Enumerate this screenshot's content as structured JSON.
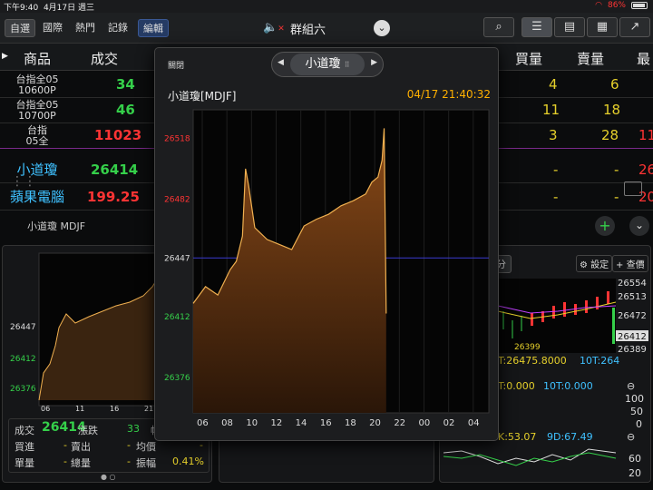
{
  "status": {
    "time": "下午9:40",
    "date": "4月17日 週三",
    "battery": "86%"
  },
  "tabs": [
    {
      "label": "自選"
    },
    {
      "label": "國際"
    },
    {
      "label": "熱門"
    },
    {
      "label": "記錄"
    }
  ],
  "edit_label": "編輯",
  "group_title": "群組六",
  "columns": {
    "name": "商品",
    "trade": "成交",
    "buy_vol": "買量",
    "sell_vol": "賣量",
    "last": "最"
  },
  "rows": [
    {
      "name1": "台指全05",
      "name2": "10600P",
      "trade": "34",
      "buy": "4",
      "sell": "6",
      "tail": ""
    },
    {
      "name1": "台指全05",
      "name2": "10700P",
      "trade": "46",
      "buy": "11",
      "sell": "18",
      "tail": ""
    },
    {
      "name1": "台指",
      "name2": "05全",
      "trade": "11023",
      "buy": "3",
      "sell": "28",
      "tail": "11"
    },
    {
      "name1": "小道瓊",
      "name2": "",
      "trade": "26414",
      "buy": "-",
      "sell": "-",
      "tail": "26"
    },
    {
      "name1": "蘋果電腦",
      "name2": "",
      "trade": "199.25",
      "buy": "-",
      "sell": "-",
      "tail": "20"
    }
  ],
  "mid_label": "小道瓊  MDJF",
  "left_panel": {
    "yticks": [
      "26447",
      "26412",
      "26376"
    ],
    "xticks": [
      "06",
      "11",
      "16",
      "21"
    ],
    "info": {
      "trade_l": "成交",
      "trade_v": "26414",
      "chg_l": "漲跌",
      "chg_v": "33",
      "amp_l": "幅度",
      "buy_l": "買進",
      "buy_v": "-",
      "sell_l": "賣出",
      "sell_v": "-",
      "avg_l": "均價",
      "avg_v": "-",
      "single_l": "單量",
      "single_v": "-",
      "total_l": "總量",
      "total_v": "-",
      "swing_l": "振幅",
      "swing_v": "0.41%"
    }
  },
  "right_panel": {
    "period_btn": "分",
    "settings": "設定",
    "add": "查價",
    "prices": [
      "26554",
      "26513",
      "26472",
      "26412",
      "26389"
    ],
    "low_mark": "26399",
    "ma_line": "T:26475.8000",
    "ma_line2": "10T:264",
    "vol_line": "T:0.000",
    "vol_line2": "10T:0.000",
    "vol_ticks": [
      "100",
      "50",
      "0"
    ],
    "kd_line": "K:53.07",
    "kd_line2": "9D:67.49",
    "kd_ticks": [
      "60",
      "20"
    ]
  },
  "popup": {
    "close": "關閉",
    "product": "小道瓊",
    "title": "小道瓊[MDJF]",
    "timestamp": "04/17 21:40:32"
  },
  "chart_data": {
    "type": "area",
    "title": "小道瓊[MDJF]",
    "x_ticks": [
      "06",
      "08",
      "10",
      "12",
      "14",
      "16",
      "18",
      "20",
      "22",
      "00",
      "02",
      "04"
    ],
    "y_ticks": [
      26518,
      26482,
      26447,
      26412,
      26376
    ],
    "reference": 26447,
    "ylim": [
      26355,
      26535
    ],
    "x": [
      "06:00",
      "07:00",
      "08:00",
      "09:00",
      "09:30",
      "10:00",
      "10:15",
      "10:30",
      "11:00",
      "12:00",
      "13:00",
      "14:00",
      "15:00",
      "16:00",
      "17:00",
      "18:00",
      "19:00",
      "20:00",
      "20:30",
      "21:00",
      "21:20",
      "21:30",
      "21:35",
      "21:40"
    ],
    "values": [
      26420,
      26430,
      26425,
      26440,
      26445,
      26460,
      26500,
      26490,
      26465,
      26458,
      26455,
      26452,
      26466,
      26470,
      26473,
      26478,
      26481,
      26485,
      26492,
      26495,
      26505,
      26524,
      26470,
      26414
    ]
  }
}
